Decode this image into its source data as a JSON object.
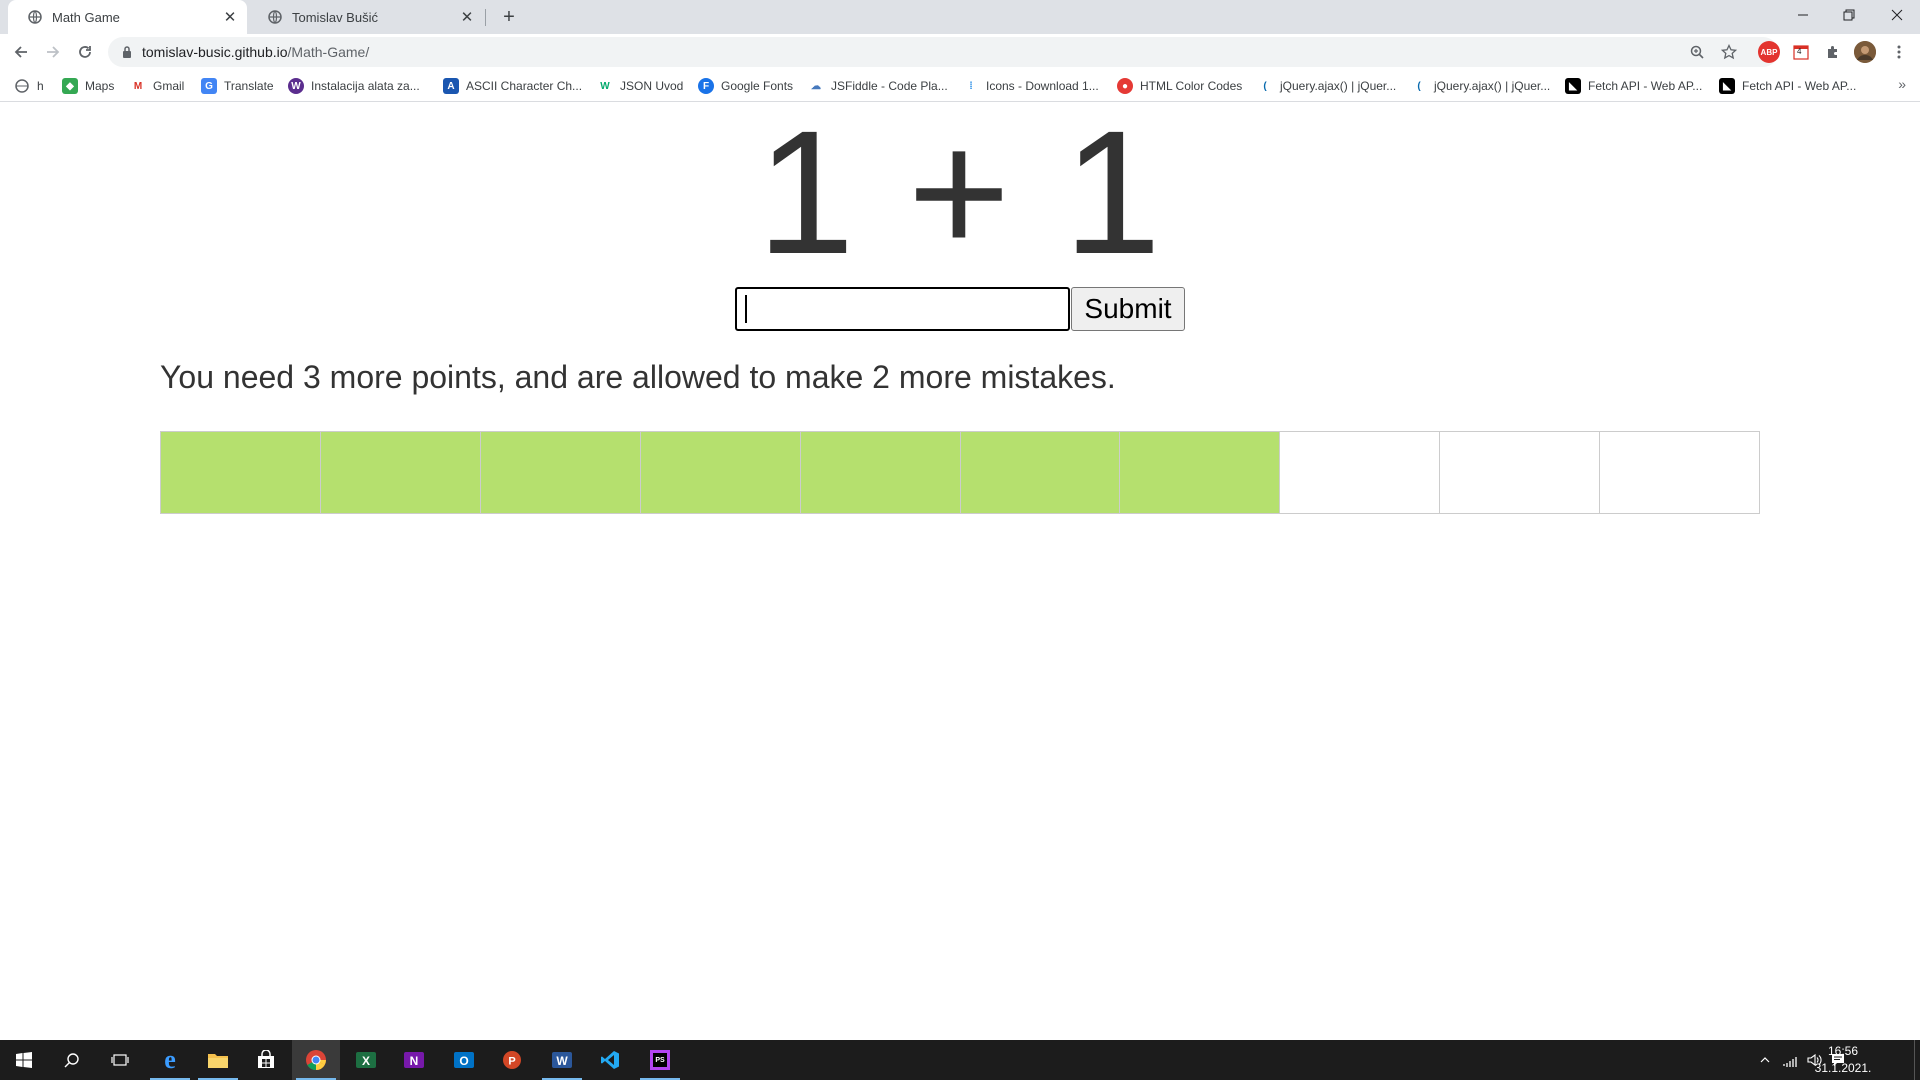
{
  "browser": {
    "tabs": [
      {
        "title": "Math Game",
        "active": true
      },
      {
        "title": "Tomislav Bušić",
        "active": false
      }
    ],
    "url": {
      "host": "tomislav-busic.github.io",
      "path": "/Math-Game/"
    },
    "extension_badge": "4",
    "bookmarks": [
      {
        "label": "h"
      },
      {
        "label": "Maps"
      },
      {
        "label": "Gmail"
      },
      {
        "label": "Translate"
      },
      {
        "label": "Instalacija alata za..."
      },
      {
        "label": "ASCII Character Ch..."
      },
      {
        "label": "JSON Uvod"
      },
      {
        "label": "Google Fonts"
      },
      {
        "label": "JSFiddle - Code Pla..."
      },
      {
        "label": "Icons - Download 1..."
      },
      {
        "label": "HTML Color Codes"
      },
      {
        "label": "jQuery.ajax() | jQuer..."
      },
      {
        "label": "jQuery.ajax() | jQuer..."
      },
      {
        "label": "Fetch API - Web AP..."
      },
      {
        "label": "Fetch API - Web AP..."
      }
    ],
    "bookmarks_more": "»"
  },
  "game": {
    "problem": "1 + 1",
    "answer_value": "",
    "submit_label": "Submit",
    "status_message": "You need 3 more points, and are allowed to make 2 more mistakes.",
    "progress_total_cells": 10,
    "progress_filled_cells": 7,
    "progress_color": "#b5e06e"
  },
  "taskbar": {
    "time": "16:56",
    "date": "31.1.2021."
  }
}
